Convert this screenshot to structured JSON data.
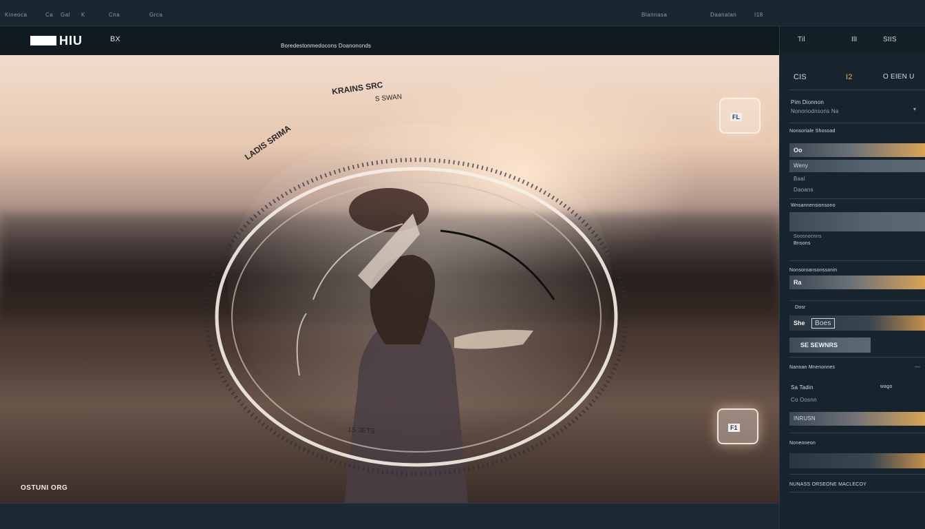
{
  "topbar": {
    "items_left": [
      "Kineoca",
      "Ca",
      "Gal",
      "K",
      "Cna",
      "Grca"
    ],
    "items_right": [
      "Blannasa",
      "Daanalan",
      "I18"
    ]
  },
  "header": {
    "logo": "HIU",
    "badge": "BX",
    "subtitle": "Boredestonmedocons  Doanononds"
  },
  "viewer": {
    "ring_text_top": "KRAINS SRC",
    "ring_text_sub": "S SWAN",
    "ring_text_left": "LADIS SRIMA",
    "ring_text_bottom": "1S 3ETS",
    "sticker_top": "FL",
    "sticker_bottom": "F1",
    "caption": "OSTUNI ORG"
  },
  "panel": {
    "top_labels": [
      "Til",
      "IlI",
      "SIIS"
    ],
    "header_left": "CIS",
    "header_mid": "I2",
    "header_right": "O EIEN U",
    "section_title": "Pim Dionnon",
    "section_sub": "Nonoriodnsons Na",
    "group1_label": "Nonsoriale Shosoad",
    "field1": "Oo",
    "field2": "Weny",
    "field3": "Baal",
    "field4": "Daoans",
    "group2_label": "Wnsannensionsono",
    "group2_sub": "Soosnocnns",
    "group2_value": "Bnsons",
    "group3_label": "Nonsoroansonssonin",
    "field5": "Ra",
    "group4_label": "Dosr",
    "field6": "She",
    "field6_value": "Boes",
    "field7": "SE SEWNRS",
    "group5_label": "Nannan Mnenonnes",
    "field8": "Sa Tadin",
    "field8_right": "wago",
    "field9": "Co Oosnn",
    "field10": "INRUSN",
    "group6_label": "Noneoneon",
    "footer_label": "NUNASS ORSEONE MACLECOY"
  },
  "colors": {
    "accent": "#d9a455",
    "panel_bg": "#17242d",
    "bar_bg": "#17242d"
  }
}
